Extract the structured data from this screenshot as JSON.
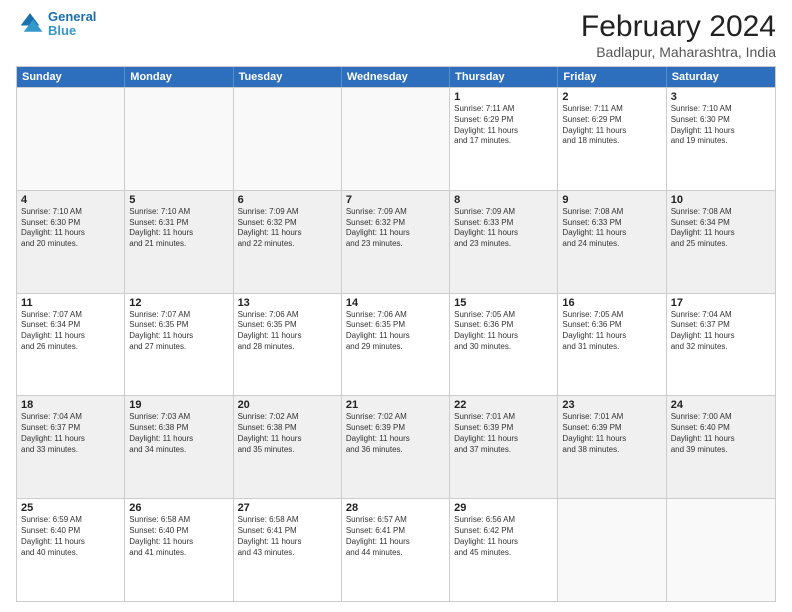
{
  "header": {
    "logo_line1": "General",
    "logo_line2": "Blue",
    "main_title": "February 2024",
    "sub_title": "Badlapur, Maharashtra, India"
  },
  "weekdays": [
    "Sunday",
    "Monday",
    "Tuesday",
    "Wednesday",
    "Thursday",
    "Friday",
    "Saturday"
  ],
  "rows": [
    [
      {
        "day": "",
        "empty": true
      },
      {
        "day": "",
        "empty": true
      },
      {
        "day": "",
        "empty": true
      },
      {
        "day": "",
        "empty": true
      },
      {
        "day": "1",
        "sunrise": "7:11 AM",
        "sunset": "6:29 PM",
        "daylight": "11 hours and 17 minutes."
      },
      {
        "day": "2",
        "sunrise": "7:11 AM",
        "sunset": "6:29 PM",
        "daylight": "11 hours and 18 minutes."
      },
      {
        "day": "3",
        "sunrise": "7:10 AM",
        "sunset": "6:30 PM",
        "daylight": "11 hours and 19 minutes."
      }
    ],
    [
      {
        "day": "4",
        "sunrise": "7:10 AM",
        "sunset": "6:30 PM",
        "daylight": "11 hours and 20 minutes."
      },
      {
        "day": "5",
        "sunrise": "7:10 AM",
        "sunset": "6:31 PM",
        "daylight": "11 hours and 21 minutes."
      },
      {
        "day": "6",
        "sunrise": "7:09 AM",
        "sunset": "6:32 PM",
        "daylight": "11 hours and 22 minutes."
      },
      {
        "day": "7",
        "sunrise": "7:09 AM",
        "sunset": "6:32 PM",
        "daylight": "11 hours and 23 minutes."
      },
      {
        "day": "8",
        "sunrise": "7:09 AM",
        "sunset": "6:33 PM",
        "daylight": "11 hours and 23 minutes."
      },
      {
        "day": "9",
        "sunrise": "7:08 AM",
        "sunset": "6:33 PM",
        "daylight": "11 hours and 24 minutes."
      },
      {
        "day": "10",
        "sunrise": "7:08 AM",
        "sunset": "6:34 PM",
        "daylight": "11 hours and 25 minutes."
      }
    ],
    [
      {
        "day": "11",
        "sunrise": "7:07 AM",
        "sunset": "6:34 PM",
        "daylight": "11 hours and 26 minutes."
      },
      {
        "day": "12",
        "sunrise": "7:07 AM",
        "sunset": "6:35 PM",
        "daylight": "11 hours and 27 minutes."
      },
      {
        "day": "13",
        "sunrise": "7:06 AM",
        "sunset": "6:35 PM",
        "daylight": "11 hours and 28 minutes."
      },
      {
        "day": "14",
        "sunrise": "7:06 AM",
        "sunset": "6:35 PM",
        "daylight": "11 hours and 29 minutes."
      },
      {
        "day": "15",
        "sunrise": "7:05 AM",
        "sunset": "6:36 PM",
        "daylight": "11 hours and 30 minutes."
      },
      {
        "day": "16",
        "sunrise": "7:05 AM",
        "sunset": "6:36 PM",
        "daylight": "11 hours and 31 minutes."
      },
      {
        "day": "17",
        "sunrise": "7:04 AM",
        "sunset": "6:37 PM",
        "daylight": "11 hours and 32 minutes."
      }
    ],
    [
      {
        "day": "18",
        "sunrise": "7:04 AM",
        "sunset": "6:37 PM",
        "daylight": "11 hours and 33 minutes."
      },
      {
        "day": "19",
        "sunrise": "7:03 AM",
        "sunset": "6:38 PM",
        "daylight": "11 hours and 34 minutes."
      },
      {
        "day": "20",
        "sunrise": "7:02 AM",
        "sunset": "6:38 PM",
        "daylight": "11 hours and 35 minutes."
      },
      {
        "day": "21",
        "sunrise": "7:02 AM",
        "sunset": "6:39 PM",
        "daylight": "11 hours and 36 minutes."
      },
      {
        "day": "22",
        "sunrise": "7:01 AM",
        "sunset": "6:39 PM",
        "daylight": "11 hours and 37 minutes."
      },
      {
        "day": "23",
        "sunrise": "7:01 AM",
        "sunset": "6:39 PM",
        "daylight": "11 hours and 38 minutes."
      },
      {
        "day": "24",
        "sunrise": "7:00 AM",
        "sunset": "6:40 PM",
        "daylight": "11 hours and 39 minutes."
      }
    ],
    [
      {
        "day": "25",
        "sunrise": "6:59 AM",
        "sunset": "6:40 PM",
        "daylight": "11 hours and 40 minutes."
      },
      {
        "day": "26",
        "sunrise": "6:58 AM",
        "sunset": "6:40 PM",
        "daylight": "11 hours and 41 minutes."
      },
      {
        "day": "27",
        "sunrise": "6:58 AM",
        "sunset": "6:41 PM",
        "daylight": "11 hours and 43 minutes."
      },
      {
        "day": "28",
        "sunrise": "6:57 AM",
        "sunset": "6:41 PM",
        "daylight": "11 hours and 44 minutes."
      },
      {
        "day": "29",
        "sunrise": "6:56 AM",
        "sunset": "6:42 PM",
        "daylight": "11 hours and 45 minutes."
      },
      {
        "day": "",
        "empty": true
      },
      {
        "day": "",
        "empty": true
      }
    ]
  ],
  "labels": {
    "sunrise": "Sunrise:",
    "sunset": "Sunset:",
    "daylight": "Daylight:"
  }
}
